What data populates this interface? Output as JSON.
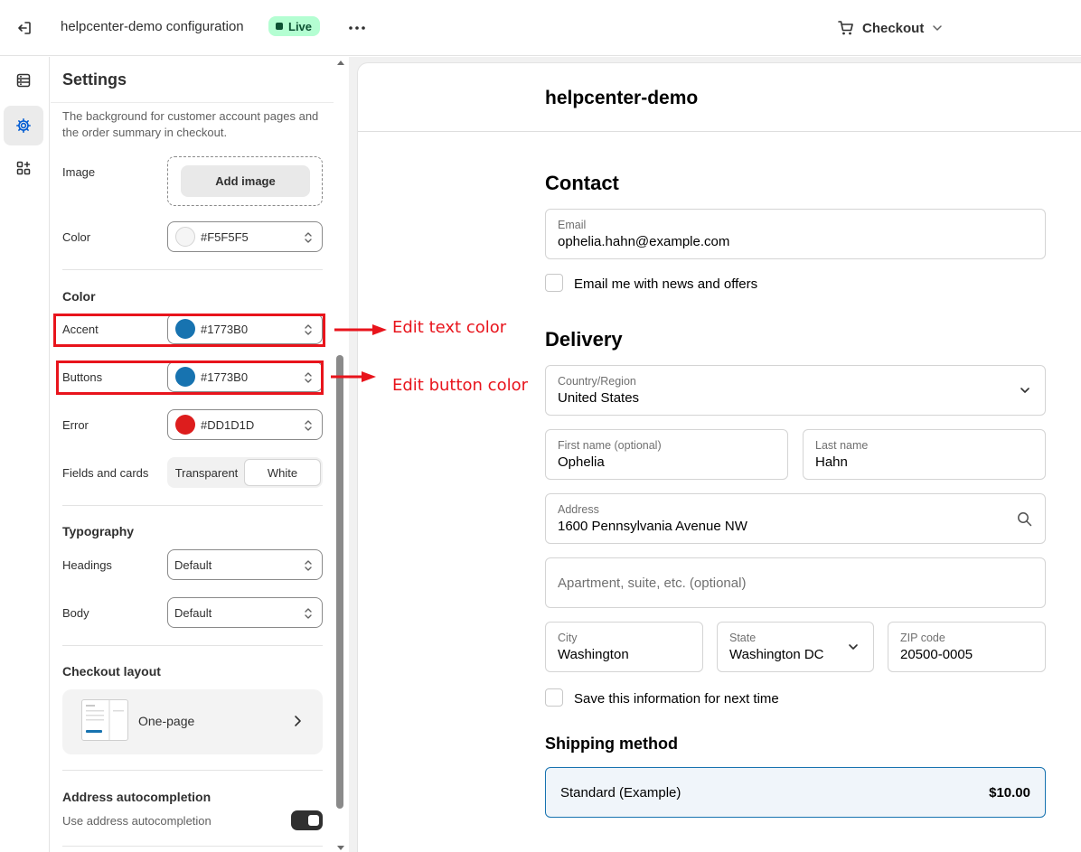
{
  "header": {
    "title": "helpcenter-demo configuration",
    "status_badge": "Live",
    "checkout_selector": "Checkout",
    "icons": [
      "exit-icon",
      "more-icon",
      "cart-icon",
      "chevron-down-icon"
    ]
  },
  "rail": {
    "items": [
      {
        "name": "sections",
        "icon": "sections-icon",
        "active": false
      },
      {
        "name": "settings",
        "icon": "gear-icon",
        "active": true
      },
      {
        "name": "apps",
        "icon": "apps-icon",
        "active": false
      }
    ]
  },
  "settings": {
    "title": "Settings",
    "background_description": "The background for customer account pages and the order summary in checkout.",
    "image_label": "Image",
    "add_image_label": "Add image",
    "background_color_label": "Color",
    "background_color_value": "#F5F5F5",
    "color_section": {
      "heading": "Color",
      "accent_label": "Accent",
      "accent_value": "#1773B0",
      "buttons_label": "Buttons",
      "buttons_value": "#1773B0",
      "error_label": "Error",
      "error_value": "#DD1D1D",
      "fields_label": "Fields and cards",
      "fields_options": [
        "Transparent",
        "White"
      ],
      "fields_selected": "White"
    },
    "typography": {
      "heading": "Typography",
      "headings_label": "Headings",
      "headings_value": "Default",
      "body_label": "Body",
      "body_value": "Default"
    },
    "checkout_layout": {
      "heading": "Checkout layout",
      "value": "One-page"
    },
    "address_autocompletion": {
      "heading": "Address autocompletion",
      "toggle_label": "Use address autocompletion",
      "enabled": true
    }
  },
  "annotations": {
    "accent": "Edit text color",
    "buttons": "Edit button color",
    "color": "#e8141c"
  },
  "preview": {
    "store_name": "helpcenter-demo",
    "contact": {
      "heading": "Contact",
      "email_label": "Email",
      "email_value": "ophelia.hahn@example.com",
      "news_checkbox": "Email me with news and offers"
    },
    "delivery": {
      "heading": "Delivery",
      "country_label": "Country/Region",
      "country_value": "United States",
      "first_name_label": "First name (optional)",
      "first_name_value": "Ophelia",
      "last_name_label": "Last name",
      "last_name_value": "Hahn",
      "address_label": "Address",
      "address_value": "1600 Pennsylvania Avenue NW",
      "apartment_placeholder": "Apartment, suite, etc. (optional)",
      "city_label": "City",
      "city_value": "Washington",
      "state_label": "State",
      "state_value": "Washington DC",
      "zip_label": "ZIP code",
      "zip_value": "20500-0005",
      "save_checkbox": "Save this information for next time"
    },
    "shipping": {
      "heading": "Shipping method",
      "option_name": "Standard (Example)",
      "option_price": "$10.00"
    }
  },
  "colors": {
    "accent": "#1773B0",
    "error": "#DD1D1D",
    "background": "#F5F5F5",
    "live_badge": "#b4fed2"
  }
}
